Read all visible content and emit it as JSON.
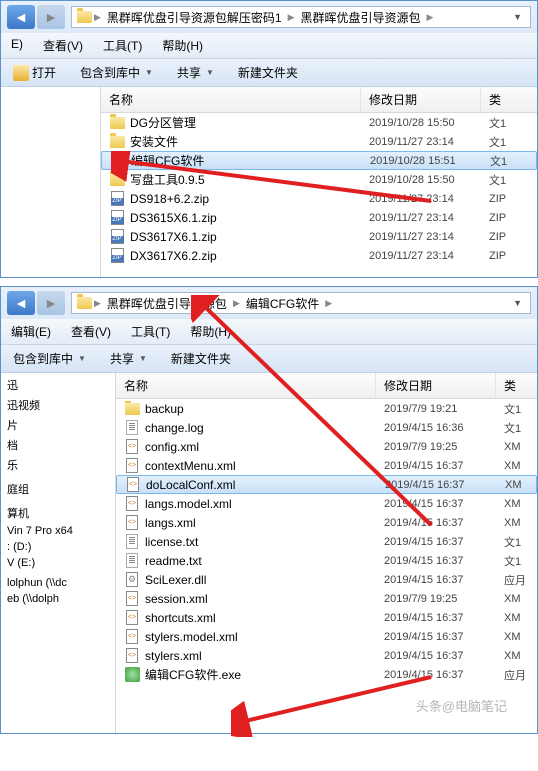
{
  "window1": {
    "breadcrumbs": [
      "黑群晖优盘引导资源包解压密码1",
      "黑群晖优盘引导资源包"
    ],
    "menu": {
      "edit": "E)",
      "view": "查看(V)",
      "tools": "工具(T)",
      "help": "帮助(H)"
    },
    "toolbar": {
      "open": "打开",
      "include": "包含到库中",
      "share": "共享",
      "newfolder": "新建文件夹"
    },
    "columns": {
      "name": "名称",
      "date": "修改日期",
      "type": "类"
    },
    "files": [
      {
        "icon": "folder",
        "name": "DG分区管理",
        "date": "2019/10/28 15:50",
        "type": "文1"
      },
      {
        "icon": "folder",
        "name": "安装文件",
        "date": "2019/11/27 23:14",
        "type": "文1"
      },
      {
        "icon": "folder",
        "name": "编辑CFG软件",
        "date": "2019/10/28 15:51",
        "type": "文1",
        "sel": true
      },
      {
        "icon": "folder",
        "name": "写盘工具0.9.5",
        "date": "2019/10/28 15:50",
        "type": "文1"
      },
      {
        "icon": "zip",
        "name": "DS918+6.2.zip",
        "date": "2019/11/27 23:14",
        "type": "ZIP"
      },
      {
        "icon": "zip",
        "name": "DS3615X6.1.zip",
        "date": "2019/11/27 23:14",
        "type": "ZIP"
      },
      {
        "icon": "zip",
        "name": "DS3617X6.1.zip",
        "date": "2019/11/27 23:14",
        "type": "ZIP"
      },
      {
        "icon": "zip",
        "name": "DX3617X6.2.zip",
        "date": "2019/11/27 23:14",
        "type": "ZIP"
      }
    ]
  },
  "window2": {
    "breadcrumbs": [
      "黑群晖优盘引导资源包",
      "编辑CFG软件"
    ],
    "menu": {
      "edit": "编辑(E)",
      "view": "查看(V)",
      "tools": "工具(T)",
      "help": "帮助(H)"
    },
    "toolbar": {
      "include": "包含到库中",
      "share": "共享",
      "newfolder": "新建文件夹"
    },
    "columns": {
      "name": "名称",
      "date": "修改日期",
      "type": "类"
    },
    "nav": [
      "迅",
      "迅视频",
      "片",
      "档",
      "乐",
      "",
      "庭组",
      "",
      "算机",
      "Vin 7 Pro x64",
      ": (D:)",
      "V (E:)",
      "",
      "lolphun (\\\\dc",
      "eb (\\\\dolph"
    ],
    "files": [
      {
        "icon": "folder",
        "name": "backup",
        "date": "2019/7/9 19:21",
        "type": "文1"
      },
      {
        "icon": "txt",
        "name": "change.log",
        "date": "2019/4/15 16:36",
        "type": "文1"
      },
      {
        "icon": "xml",
        "name": "config.xml",
        "date": "2019/7/9 19:25",
        "type": "XM"
      },
      {
        "icon": "xml",
        "name": "contextMenu.xml",
        "date": "2019/4/15 16:37",
        "type": "XM"
      },
      {
        "icon": "xml",
        "name": "doLocalConf.xml",
        "date": "2019/4/15 16:37",
        "type": "XM",
        "sel": true
      },
      {
        "icon": "xml",
        "name": "langs.model.xml",
        "date": "2019/4/15 16:37",
        "type": "XM"
      },
      {
        "icon": "xml",
        "name": "langs.xml",
        "date": "2019/4/15 16:37",
        "type": "XM"
      },
      {
        "icon": "txt",
        "name": "license.txt",
        "date": "2019/4/15 16:37",
        "type": "文1"
      },
      {
        "icon": "txt",
        "name": "readme.txt",
        "date": "2019/4/15 16:37",
        "type": "文1"
      },
      {
        "icon": "dll",
        "name": "SciLexer.dll",
        "date": "2019/4/15 16:37",
        "type": "应月"
      },
      {
        "icon": "xml",
        "name": "session.xml",
        "date": "2019/7/9 19:25",
        "type": "XM"
      },
      {
        "icon": "xml",
        "name": "shortcuts.xml",
        "date": "2019/4/15 16:37",
        "type": "XM"
      },
      {
        "icon": "xml",
        "name": "stylers.model.xml",
        "date": "2019/4/15 16:37",
        "type": "XM"
      },
      {
        "icon": "xml",
        "name": "stylers.xml",
        "date": "2019/4/15 16:37",
        "type": "XM"
      },
      {
        "icon": "exe",
        "name": "编辑CFG软件.exe",
        "date": "2019/4/15 16:37",
        "type": "应月"
      }
    ]
  },
  "watermark": "头条@电脑笔记"
}
